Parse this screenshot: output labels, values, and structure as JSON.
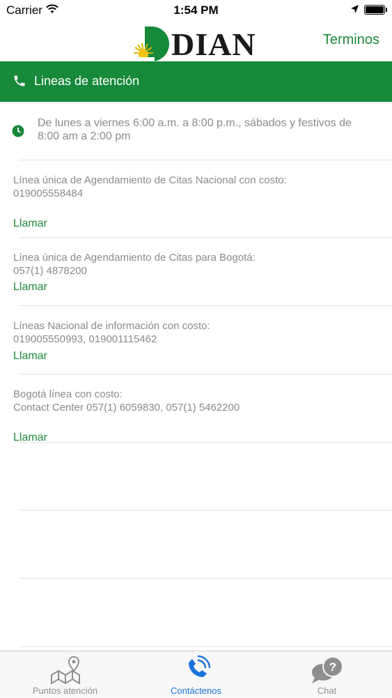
{
  "status_bar": {
    "carrier": "Carrier",
    "time": "1:54 PM"
  },
  "header": {
    "logo_text": "DIAN",
    "terms_link": "Terminos"
  },
  "section": {
    "title": "Lineas de atención",
    "accent_color": "#16893a"
  },
  "hours": {
    "text": "De lunes a viernes 6:00 a.m. a 8:00 p.m., sábados y festivos de 8:00 am a 2:00 pm"
  },
  "entries": [
    {
      "label": "Línea única de Agendamiento de Citas Nacional con costo:",
      "number": "019005558484",
      "call": "Llamar"
    },
    {
      "label": "Línea única de Agendamiento de Citas para Bogotá:",
      "number": "057(1) 4878200",
      "call": "Llamar"
    },
    {
      "label": "Líneas Nacional de información con costo:",
      "number": "019005550993, 019001115462",
      "call": "Llamar"
    },
    {
      "label": "Bogotá línea con costo:",
      "number": "Contact Center 057(1) 6059830, 057(1) 5462200",
      "call": "Llamar"
    }
  ],
  "tabs": [
    {
      "label": "Puntos atención",
      "icon": "map-pin-icon",
      "active": false
    },
    {
      "label": "Contáctenos",
      "icon": "phone-call-icon",
      "active": true
    },
    {
      "label": "Chat",
      "icon": "chat-question-icon",
      "active": false
    }
  ],
  "colors": {
    "active_tab": "#1a73d9",
    "inactive_tab": "#8e8e8e",
    "link": "#1e8a3a"
  }
}
